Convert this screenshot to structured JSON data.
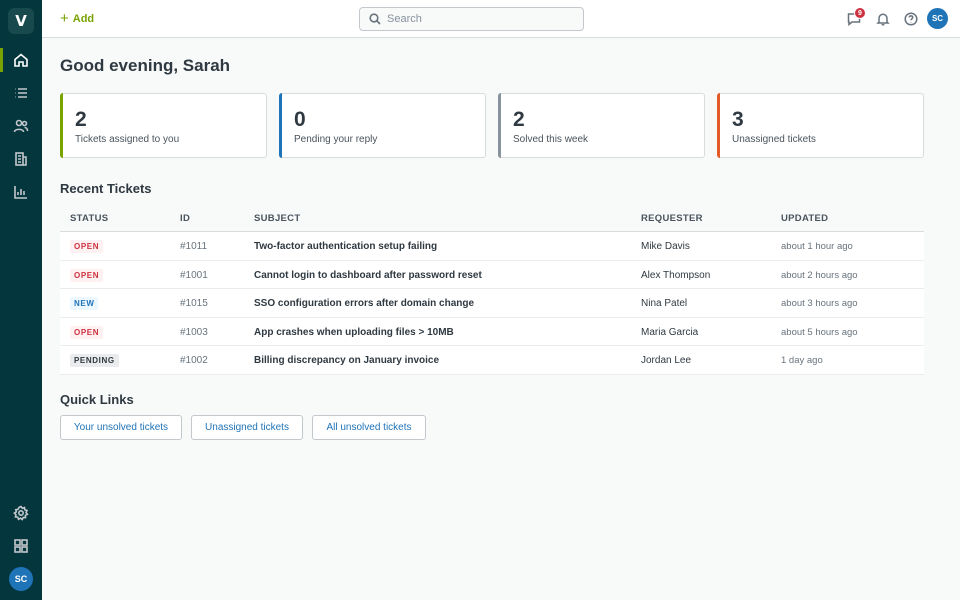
{
  "sidebar": {
    "logo_letter": "V",
    "items": [
      {
        "name": "home",
        "icon": "home-icon",
        "active": true
      },
      {
        "name": "views",
        "icon": "list-icon",
        "active": false
      },
      {
        "name": "customers",
        "icon": "users-icon",
        "active": false
      },
      {
        "name": "organizations",
        "icon": "building-icon",
        "active": false
      },
      {
        "name": "reporting",
        "icon": "chart-icon",
        "active": false
      }
    ],
    "bottom_items": [
      {
        "name": "settings",
        "icon": "gear-icon"
      },
      {
        "name": "apps",
        "icon": "grid-icon"
      }
    ],
    "avatar_initials": "SC"
  },
  "topbar": {
    "add_label": "Add",
    "search_placeholder": "Search",
    "conversations_badge": "9",
    "avatar_initials": "SC"
  },
  "greeting": "Good evening, Sarah",
  "stats": [
    {
      "value": "2",
      "label": "Tickets assigned to you",
      "accent": "#78a300"
    },
    {
      "value": "0",
      "label": "Pending your reply",
      "accent": "#1f73b7"
    },
    {
      "value": "2",
      "label": "Solved this week",
      "accent": "#87929d"
    },
    {
      "value": "3",
      "label": "Unassigned tickets",
      "accent": "#e35b29"
    }
  ],
  "recent": {
    "title": "Recent Tickets",
    "columns": {
      "status": "STATUS",
      "id": "ID",
      "subject": "SUBJECT",
      "requester": "REQUESTER",
      "updated": "UPDATED"
    },
    "rows": [
      {
        "status": "OPEN",
        "status_type": "open",
        "id": "#1011",
        "subject": "Two-factor authentication setup failing",
        "requester": "Mike Davis",
        "updated": "about 1 hour ago"
      },
      {
        "status": "OPEN",
        "status_type": "open",
        "id": "#1001",
        "subject": "Cannot login to dashboard after password reset",
        "requester": "Alex Thompson",
        "updated": "about 2 hours ago"
      },
      {
        "status": "NEW",
        "status_type": "new",
        "id": "#1015",
        "subject": "SSO configuration errors after domain change",
        "requester": "Nina Patel",
        "updated": "about 3 hours ago"
      },
      {
        "status": "OPEN",
        "status_type": "open",
        "id": "#1003",
        "subject": "App crashes when uploading files > 10MB",
        "requester": "Maria Garcia",
        "updated": "about 5 hours ago"
      },
      {
        "status": "PENDING",
        "status_type": "pending",
        "id": "#1002",
        "subject": "Billing discrepancy on January invoice",
        "requester": "Jordan Lee",
        "updated": "1 day ago"
      }
    ]
  },
  "quick_links": {
    "title": "Quick Links",
    "items": [
      "Your unsolved tickets",
      "Unassigned tickets",
      "All unsolved tickets"
    ]
  }
}
